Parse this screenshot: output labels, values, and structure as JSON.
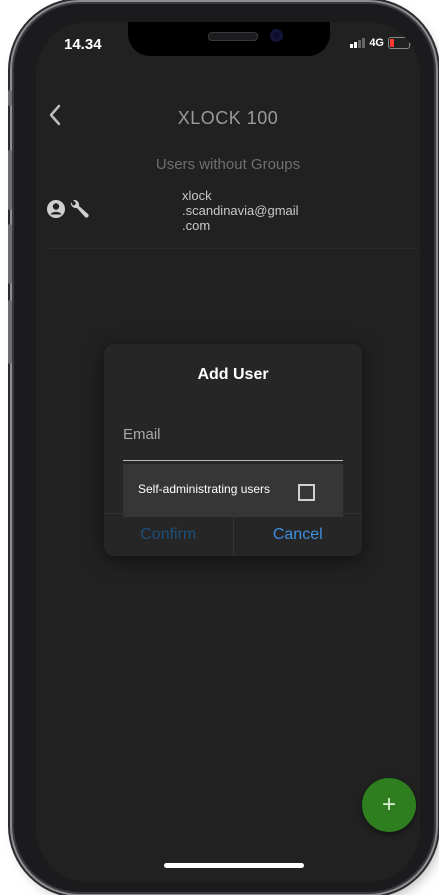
{
  "status_bar": {
    "time": "14.34",
    "network": "4G"
  },
  "header": {
    "title": "XLOCK 100"
  },
  "section": {
    "title": "Users without Groups"
  },
  "users": [
    {
      "email": "xlock\n.scandinavia@gmail\n.com",
      "icons": [
        "user-circle-icon",
        "wrench-icon"
      ]
    }
  ],
  "dialog": {
    "title": "Add User",
    "email_placeholder": "Email",
    "checkbox_label": "Self-administrating users",
    "checkbox_checked": false,
    "confirm_label": "Confirm",
    "cancel_label": "Cancel"
  },
  "fab": {
    "label": "+"
  },
  "colors": {
    "fab": "#2e7d1e",
    "cancel": "#3d8fe0",
    "confirm_disabled": "#1e4f7a",
    "battery": "#ff3b30"
  }
}
